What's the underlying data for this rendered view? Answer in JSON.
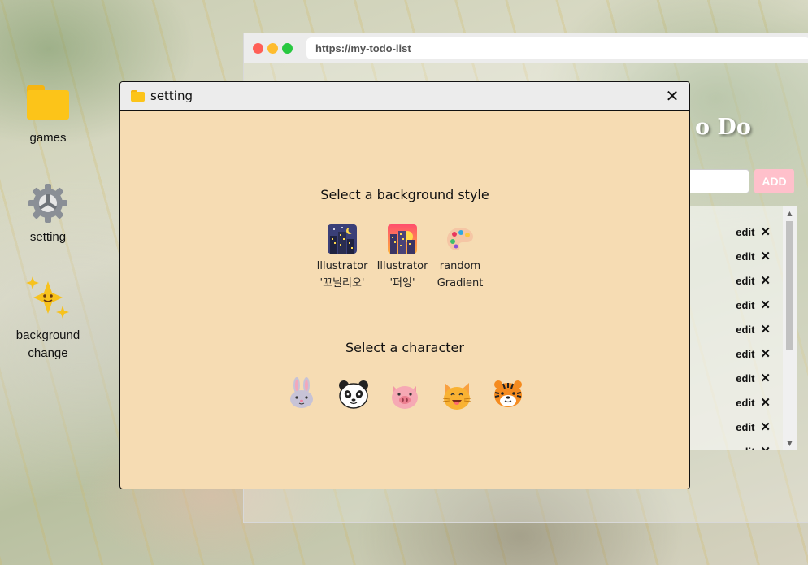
{
  "desktop": {
    "icons": [
      {
        "label": "games",
        "icon": "folder-icon"
      },
      {
        "label": "setting",
        "icon": "gear-icon"
      },
      {
        "label": "background change",
        "icon": "sparkles-icon"
      }
    ]
  },
  "browser": {
    "url": "https://my-todo-list",
    "title_fragment": "o Do",
    "add_label": "ADD",
    "todo_items": [
      {
        "edit": "edit",
        "delete": "✕"
      },
      {
        "edit": "edit",
        "delete": "✕"
      },
      {
        "edit": "edit",
        "delete": "✕"
      },
      {
        "edit": "edit",
        "delete": "✕"
      },
      {
        "edit": "edit",
        "delete": "✕"
      },
      {
        "edit": "edit",
        "delete": "✕"
      },
      {
        "edit": "edit",
        "delete": "✕"
      },
      {
        "edit": "edit",
        "delete": "✕"
      },
      {
        "edit": "edit",
        "delete": "✕"
      },
      {
        "edit": "edit",
        "delete": "✕"
      }
    ]
  },
  "dialog": {
    "title": "setting",
    "close": "✕",
    "bg_section_title": "Select a background style",
    "bg_options": [
      {
        "line1": "Illustrator",
        "line2": "'꼬닐리오'",
        "icon": "night-city-icon"
      },
      {
        "line1": "Illustrator",
        "line2": "'퍼엉'",
        "icon": "sunset-city-icon"
      },
      {
        "line1": "random",
        "line2": "Gradient",
        "icon": "palette-icon"
      }
    ],
    "char_section_title": "Select a character",
    "characters": [
      "rabbit",
      "panda",
      "pig",
      "cat",
      "tiger"
    ]
  },
  "colors": {
    "dialog_bg": "#f6dcb3",
    "folder": "#fcc419",
    "add_button": "#ffc0cb"
  }
}
